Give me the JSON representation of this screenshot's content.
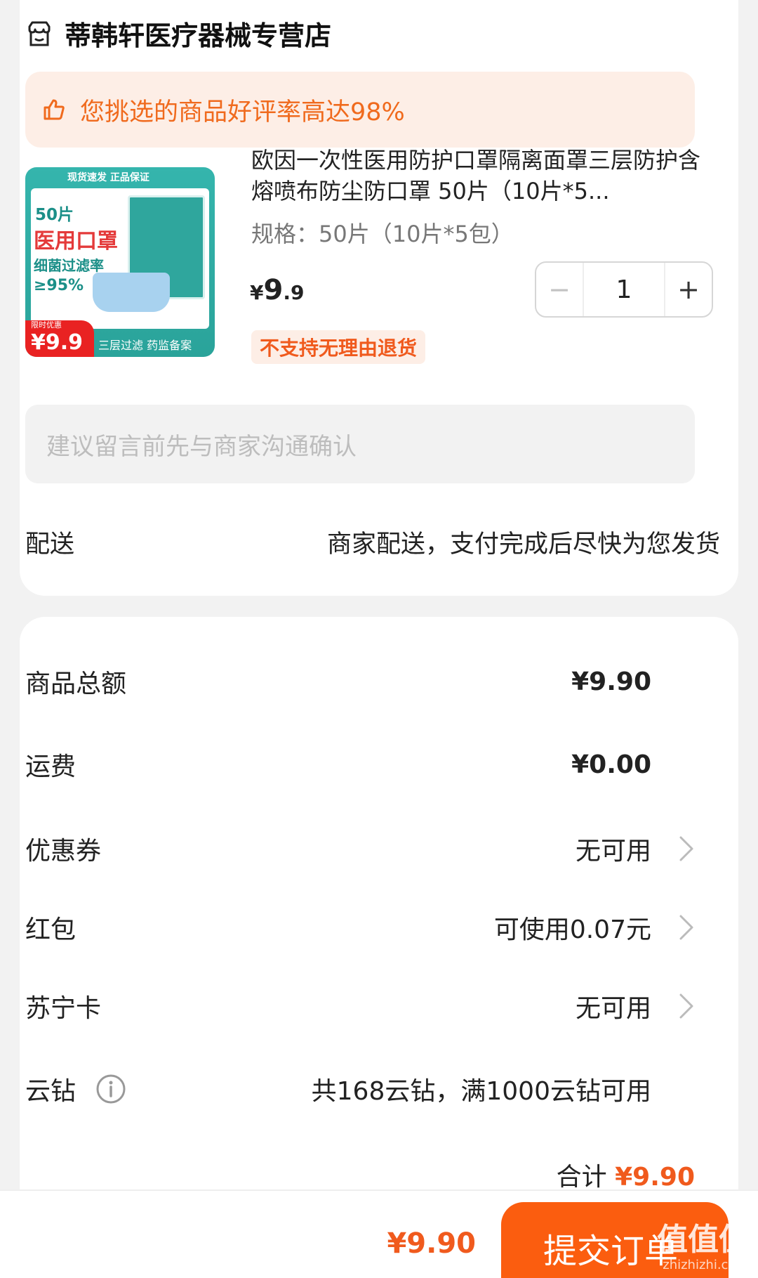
{
  "shop": {
    "name": "蒂韩轩医疗器械专营店",
    "icon": "store-icon"
  },
  "praise": {
    "text": "您挑选的商品好评率高达98%",
    "icon": "thumb-up-icon"
  },
  "product": {
    "title": "欧因一次性医用防护口罩隔离面罩三层防护含熔喷布防尘防口罩 50片（10片*5...",
    "spec": "规格：50片（10片*5包）",
    "price_currency": "¥",
    "price_int": "9",
    "price_dec": ".9",
    "quantity": "1",
    "minus": "−",
    "plus": "+",
    "return_policy": "不支持无理由退货",
    "image_text": {
      "top": "现货速发  正品保证",
      "line1": "50片",
      "line2": "医用口罩",
      "line3": "细菌过滤率",
      "line4": "≥95%",
      "promo_small": "限时优惠",
      "promo_price": "¥9.9元",
      "bottom": "三层过滤  药监备案"
    }
  },
  "message": {
    "placeholder": "建议留言前先与商家沟通确认"
  },
  "delivery": {
    "label": "配送",
    "value": "商家配送，支付完成后尽快为您发货"
  },
  "summary": {
    "goods_total_label": "商品总额",
    "goods_total_value": "¥9.90",
    "shipping_label": "运费",
    "shipping_value": "¥0.00",
    "coupon_label": "优惠券",
    "coupon_value": "无可用",
    "redpacket_label": "红包",
    "redpacket_value": "可使用0.07元",
    "suningcard_label": "苏宁卡",
    "suningcard_value": "无可用",
    "yunzuan_label": "云钻",
    "yunzuan_value": "共168云钻，满1000云钻可用",
    "total_label": "合计",
    "total_value": "¥9.90"
  },
  "bottom_bar": {
    "price": "¥9.90",
    "submit_label": "提交订单"
  },
  "watermark": {
    "text": "值值值",
    "sub": "zhizhizhi.com"
  },
  "colors": {
    "accent": "#fb5d0f",
    "accent_text": "#f05a1d",
    "praise_bg": "#fdeee6"
  }
}
